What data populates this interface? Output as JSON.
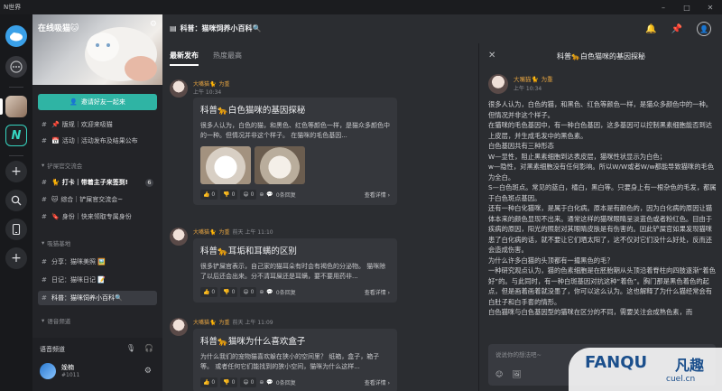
{
  "app": {
    "title": "N世界"
  },
  "window_controls": {
    "minimize": "–",
    "maximize": "□",
    "close": "✕"
  },
  "server": {
    "banner_title": "在线吸猫🐱",
    "invite_label": "邀请好友一起来",
    "channels_top": [
      {
        "glyph": "📌",
        "label": "版规｜欢迎来吸猫"
      },
      {
        "glyph": "📅",
        "label": "活动｜活动发布及结果公布"
      }
    ],
    "group1": "铲屎官交流会",
    "channels_g1": [
      {
        "glyph": "🐈",
        "label": "打卡｜带着主子来签到!",
        "count": "6"
      },
      {
        "glyph": "🐱",
        "label": "综合｜铲屎官交流会~"
      },
      {
        "glyph": "🔖",
        "label": "身份｜快来领取专属身份"
      }
    ],
    "group2": "吸猫基地",
    "channels_g2": [
      {
        "label": "分享：猫咪美照 🖼️"
      },
      {
        "label": "日记：猫咪日记 📝"
      },
      {
        "label": "科普：猫咪饲养小百科🔍",
        "active": true
      }
    ],
    "group3": "语音频道"
  },
  "voice": {
    "label": "语音频道",
    "user": "娩楠",
    "user_id": "#1011"
  },
  "main": {
    "header": "科普：猫咪饲养小百科🔍",
    "tabs": [
      "最新发布",
      "热度最高"
    ],
    "posts": [
      {
        "author": "大嘴猫🐈",
        "tag": "为重",
        "time": "上午 10:34",
        "title": "科普🐆白色猫咪的基因探秘",
        "body": "很多人认为，白色的猫，和黑色、红色等颜色一样，是猫众多颜色中的一种。但情况并非这个样子。 在猫咪的毛色基因...",
        "has_images": true,
        "reactions": [
          "👍 0",
          "👎 0",
          "😄 0"
        ],
        "comments": "0条回复",
        "detail_label": "查看详情 ›"
      },
      {
        "author": "大嘴猫🐈",
        "tag": "为重",
        "time": "前天 上午 11:10",
        "title": "科普🐆耳垢和耳螨的区别",
        "body": "很多铲屎官表示，自己家的猫耳朵有时会有褐色的分泌物。 猫咪除了以后还会出来。分不清耳屎还是耳螨，要不要用药非...",
        "has_images": false,
        "reactions": [
          "👍 0",
          "👎 0",
          "😄 0"
        ],
        "comments": "0条回复",
        "detail_label": "查看详情 ›"
      },
      {
        "author": "大嘴猫🐈",
        "tag": "为重",
        "time": "前天 上午 11:09",
        "title": "科普🐆猫咪为什么喜欢盒子",
        "body": "为什么我们的宠物猫喜欢躲在狭小的空间里？ 纸箱，盒子，箱子等。 或者任何它们能找到的狭小空间，猫咪为什么这样...",
        "has_images": false,
        "reactions": [
          "👍 0",
          "👎 0",
          "😄 0"
        ],
        "comments": "0条回复",
        "detail_label": "查看详情 ›"
      }
    ]
  },
  "detail": {
    "title": "科普🐆白色猫咪的基因探秘",
    "author": "大嘴猫🐈",
    "tag": "为重",
    "time": "上午 10:34",
    "body": "很多人认为，白色的猫，和黑色、红色等颜色一样，是猫众多颜色中的一种。但情况并非这个样子。\n在猫咪的毛色基因中，有一种白色基因，这多基因可以控制黑素细胞能否到达上皮层，并生成毛发中的黑色素。\n白色基因共有三种形态\nW—显性，阻止黑素细胞到达表皮层，猫咪性状显示为白色；\nw—隐性，对黑素细胞没有任何影响。所以W/W或者W/w都能导致猫咪的毛色为全白。\nS—白色斑点。常见的蓝白，橘白，黑白等。只要身上有一根杂色的毛发，都属于白色斑点基因。\n还有一种白化猫咪，是属于白化病。原本是有颜色的，因为白化病的原因让猫体本来的颜色显现不出来。通常这样的猫咪眼睛呈淡蓝色或者粉红色。目由于疾病的原因，阳光的照射对其眼睛皮肤是有伤害的。因此铲屎官如果发现猫咪患了白化病的话，就不要让它们晒太阳了，这不仅对它们没什么好处，反而还会造成伤害。\n为什么许多白猫的头顶都有一撮黑色的毛？\n一种研究观点认为，猫的色素细胞是在胚胎期从头顶沿着脊柱向四肢逐渐“着色好”的。与此同时，有一种白斑基因对抗这种“着色”。胸门那是黑色着色的起点，但是画着画着就没墨了，你可以这么认为。这也解释了为什么猫经常会有白肚子和白手套的情形。\n白色猫咪与白色基因型的猫咪在区分的不同，需要关注会成熟色素，而",
    "reply_placeholder": "说说你的想法吧~"
  },
  "watermark": {
    "brand": "FANQU",
    "cn": "凡趣",
    "domain": "cuel.cn"
  }
}
